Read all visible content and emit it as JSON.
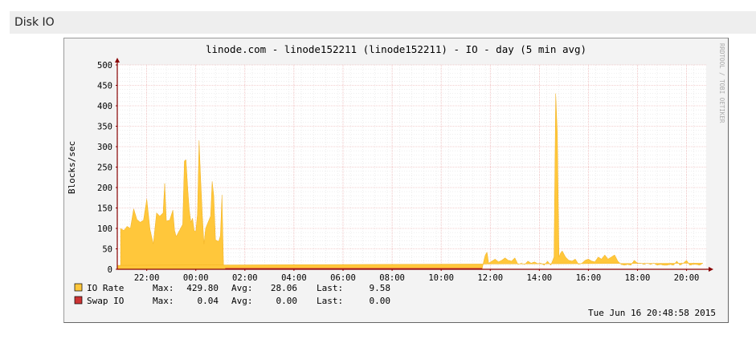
{
  "header": {
    "title": "Disk IO"
  },
  "chart_data": {
    "type": "area",
    "title": "linode.com - linode152211 (linode152211) - IO - day (5 min avg)",
    "ylabel": "Blocks/sec",
    "xlabel": "",
    "watermark": "RRDTOOL / TOBI OETIKER",
    "ylim": [
      0,
      500
    ],
    "yticks": [
      "0",
      "50",
      "100",
      "150",
      "200",
      "250",
      "300",
      "350",
      "400",
      "450",
      "500"
    ],
    "xticks": [
      "22:00",
      "00:00",
      "02:00",
      "04:00",
      "06:00",
      "08:00",
      "10:00",
      "12:00",
      "14:00",
      "16:00",
      "18:00",
      "20:00"
    ],
    "grid": true,
    "colors": {
      "io_rate": "#ffc73b",
      "io_rate_line": "#f0b020",
      "swap_io": "#cc3333",
      "grid_major": "#e8a0a0",
      "grid_minor": "#dddddd",
      "axis": "#880000",
      "background": "#f3f3f3",
      "plot_bg": "#ffffff"
    },
    "series": [
      {
        "name": "IO Rate",
        "stats": {
          "max_label": "Max:",
          "max": "429.80",
          "avg_label": "Avg:",
          "avg": "28.06",
          "last_label": "Last:",
          "last": "9.58"
        },
        "points": [
          [
            "20:56",
            100
          ],
          [
            "21:04",
            95
          ],
          [
            "21:12",
            105
          ],
          [
            "21:20",
            100
          ],
          [
            "21:28",
            148
          ],
          [
            "21:36",
            122
          ],
          [
            "21:44",
            115
          ],
          [
            "21:52",
            120
          ],
          [
            "22:00",
            172
          ],
          [
            "22:08",
            98
          ],
          [
            "22:16",
            62
          ],
          [
            "22:24",
            138
          ],
          [
            "22:32",
            130
          ],
          [
            "22:40",
            138
          ],
          [
            "22:44",
            210
          ],
          [
            "22:48",
            118
          ],
          [
            "22:56",
            120
          ],
          [
            "23:04",
            145
          ],
          [
            "23:08",
            95
          ],
          [
            "23:12",
            80
          ],
          [
            "23:20",
            95
          ],
          [
            "23:28",
            110
          ],
          [
            "23:32",
            265
          ],
          [
            "23:36",
            268
          ],
          [
            "23:40",
            200
          ],
          [
            "23:44",
            145
          ],
          [
            "23:48",
            115
          ],
          [
            "23:52",
            125
          ],
          [
            "23:56",
            95
          ],
          [
            "00:00",
            92
          ],
          [
            "00:04",
            135
          ],
          [
            "00:08",
            315
          ],
          [
            "00:12",
            220
          ],
          [
            "00:16",
            130
          ],
          [
            "00:20",
            62
          ],
          [
            "00:24",
            100
          ],
          [
            "00:32",
            120
          ],
          [
            "00:36",
            130
          ],
          [
            "00:40",
            215
          ],
          [
            "00:44",
            180
          ],
          [
            "00:48",
            72
          ],
          [
            "00:56",
            68
          ],
          [
            "01:00",
            82
          ],
          [
            "01:04",
            182
          ],
          [
            "01:08",
            0
          ],
          [
            "01:12",
            0
          ],
          [
            "11:40",
            0
          ],
          [
            "11:44",
            20
          ],
          [
            "11:48",
            35
          ],
          [
            "11:52",
            42
          ],
          [
            "11:56",
            15
          ],
          [
            "12:04",
            20
          ],
          [
            "12:12",
            25
          ],
          [
            "12:20",
            18
          ],
          [
            "12:28",
            22
          ],
          [
            "12:36",
            28
          ],
          [
            "12:44",
            22
          ],
          [
            "12:52",
            20
          ],
          [
            "13:00",
            28
          ],
          [
            "13:08",
            12
          ],
          [
            "13:16",
            15
          ],
          [
            "13:24",
            12
          ],
          [
            "13:32",
            20
          ],
          [
            "13:40",
            15
          ],
          [
            "13:48",
            18
          ],
          [
            "13:56",
            14
          ],
          [
            "14:04",
            15
          ],
          [
            "14:12",
            10
          ],
          [
            "14:20",
            20
          ],
          [
            "14:28",
            10
          ],
          [
            "14:36",
            30
          ],
          [
            "14:40",
            429.8
          ],
          [
            "14:44",
            335
          ],
          [
            "14:48",
            30
          ],
          [
            "14:52",
            40
          ],
          [
            "14:56",
            45
          ],
          [
            "15:04",
            30
          ],
          [
            "15:12",
            22
          ],
          [
            "15:20",
            20
          ],
          [
            "15:28",
            25
          ],
          [
            "15:36",
            12
          ],
          [
            "15:44",
            15
          ],
          [
            "15:52",
            22
          ],
          [
            "16:00",
            25
          ],
          [
            "16:08",
            20
          ],
          [
            "16:16",
            18
          ],
          [
            "16:24",
            30
          ],
          [
            "16:32",
            25
          ],
          [
            "16:40",
            35
          ],
          [
            "16:48",
            25
          ],
          [
            "16:56",
            30
          ],
          [
            "17:04",
            35
          ],
          [
            "17:12",
            20
          ],
          [
            "17:20",
            12
          ],
          [
            "17:28",
            10
          ],
          [
            "17:36",
            12
          ],
          [
            "17:44",
            10
          ],
          [
            "17:52",
            22
          ],
          [
            "18:00",
            15
          ],
          [
            "18:08",
            15
          ],
          [
            "18:16",
            12
          ],
          [
            "18:24",
            15
          ],
          [
            "18:32",
            12
          ],
          [
            "18:40",
            15
          ],
          [
            "18:48",
            10
          ],
          [
            "18:56",
            12
          ],
          [
            "19:04",
            10
          ],
          [
            "19:12",
            10
          ],
          [
            "19:20",
            12
          ],
          [
            "19:28",
            10
          ],
          [
            "19:36",
            20
          ],
          [
            "19:44",
            10
          ],
          [
            "19:52",
            15
          ],
          [
            "20:00",
            22
          ],
          [
            "20:08",
            10
          ],
          [
            "20:16",
            12
          ],
          [
            "20:24",
            12
          ],
          [
            "20:32",
            10
          ],
          [
            "20:40",
            15
          ],
          [
            "20:48",
            9.58
          ]
        ]
      },
      {
        "name": "Swap IO",
        "stats": {
          "max_label": "Max:",
          "max": "0.04",
          "avg_label": "Avg:",
          "avg": "0.00",
          "last_label": "Last:",
          "last": "0.00"
        },
        "segments": [
          [
            "01:12",
            "11:40"
          ]
        ],
        "value": 0
      }
    ],
    "timestamp": "Tue Jun 16 20:48:58 2015"
  }
}
